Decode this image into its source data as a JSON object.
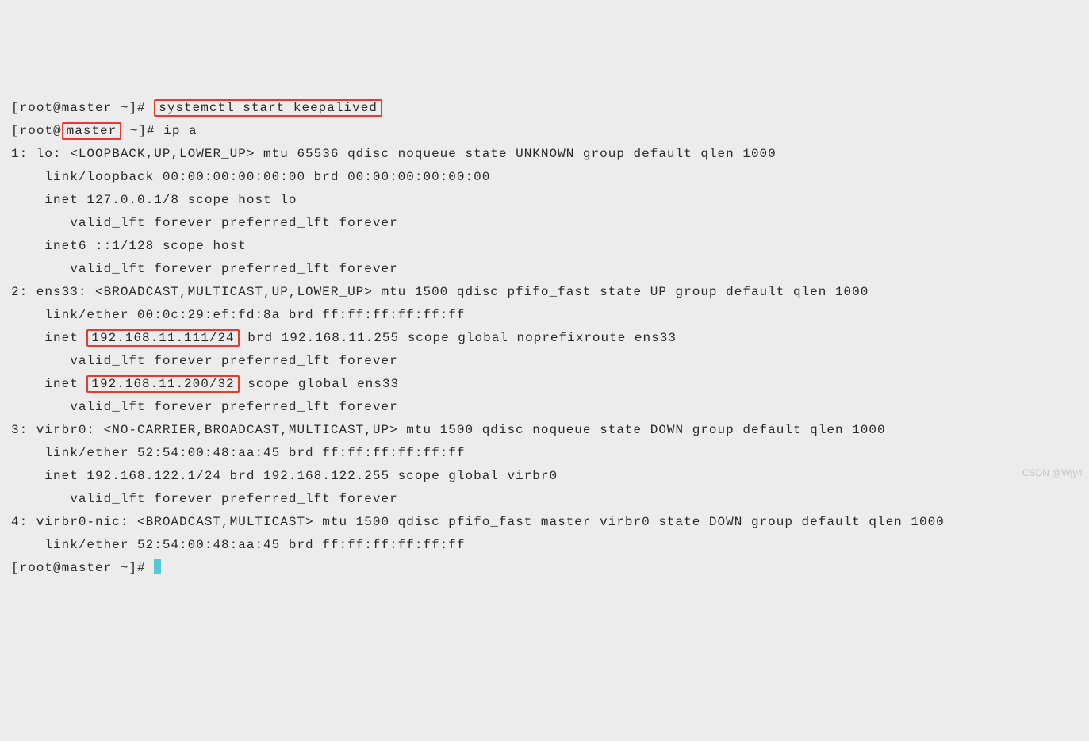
{
  "prompt1": {
    "user": "root",
    "at": "@",
    "host": "master",
    "dir": " ~",
    "bracket_open": "[",
    "bracket_close": "]# ",
    "command": "systemctl start keepalived"
  },
  "prompt2": {
    "user": "root",
    "at": "@",
    "host": "master",
    "dir": " ~",
    "bracket_open": "[",
    "bracket_close": "]# ",
    "command": "ip a"
  },
  "iface1": {
    "header": "1: lo: <LOOPBACK,UP,LOWER_UP> mtu 65536 qdisc noqueue state UNKNOWN group default qlen 1000",
    "link": "    link/loopback 00:00:00:00:00:00 brd 00:00:00:00:00:00",
    "inet": "    inet 127.0.0.1/8 scope host lo",
    "valid1": "       valid_lft forever preferred_lft forever",
    "inet6": "    inet6 ::1/128 scope host ",
    "valid2": "       valid_lft forever preferred_lft forever"
  },
  "iface2": {
    "header": "2: ens33: <BROADCAST,MULTICAST,UP,LOWER_UP> mtu 1500 qdisc pfifo_fast state UP group default qlen 1000",
    "link": "    link/ether 00:0c:29:ef:fd:8a brd ff:ff:ff:ff:ff:ff",
    "inet_a_pre": "    inet ",
    "inet_a_ip": "192.168.11.111/24",
    "inet_a_post": " brd 192.168.11.255 scope global noprefixroute ens33",
    "valid1": "       valid_lft forever preferred_lft forever",
    "inet_b_pre": "    inet ",
    "inet_b_ip": "192.168.11.200/32",
    "inet_b_post": " scope global ens33",
    "valid2": "       valid_lft forever preferred_lft forever"
  },
  "iface3": {
    "header": "3: virbr0: <NO-CARRIER,BROADCAST,MULTICAST,UP> mtu 1500 qdisc noqueue state DOWN group default qlen 1000",
    "link": "    link/ether 52:54:00:48:aa:45 brd ff:ff:ff:ff:ff:ff",
    "inet": "    inet 192.168.122.1/24 brd 192.168.122.255 scope global virbr0",
    "valid1": "       valid_lft forever preferred_lft forever"
  },
  "iface4": {
    "header": "4: virbr0-nic: <BROADCAST,MULTICAST> mtu 1500 qdisc pfifo_fast master virbr0 state DOWN group default qlen 1000",
    "link": "    link/ether 52:54:00:48:aa:45 brd ff:ff:ff:ff:ff:ff"
  },
  "prompt3": {
    "full": "[root@master ~]# "
  },
  "watermark": "CSDN @Wjy4"
}
